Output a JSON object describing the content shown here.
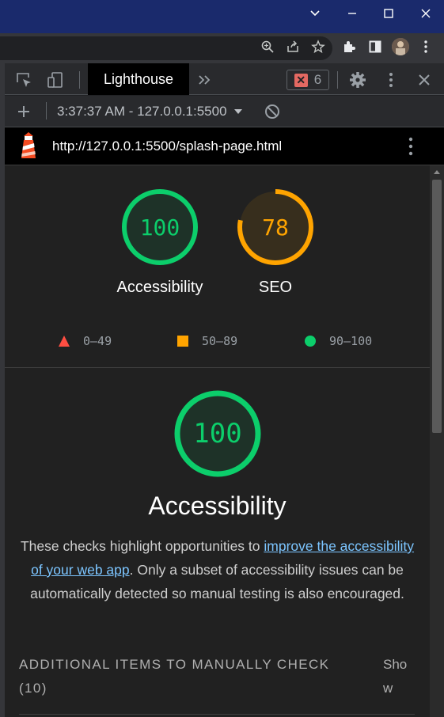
{
  "devtools": {
    "panel_tab": "Lighthouse",
    "error_count": "6",
    "report_selector": "3:37:37 AM - 127.0.0.1:5500",
    "url": "http://127.0.0.1:5500/splash-page.html"
  },
  "summary": {
    "gauges": [
      {
        "score": "100",
        "label": "Accessibility",
        "value": 100,
        "color": "#0cce6b"
      },
      {
        "score": "78",
        "label": "SEO",
        "value": 78,
        "color": "#ffa400"
      }
    ],
    "legend": [
      {
        "range": "0–49",
        "color": "#ff4e42",
        "icon": "triangle"
      },
      {
        "range": "50–89",
        "color": "#ffa400",
        "icon": "square"
      },
      {
        "range": "90–100",
        "color": "#0cce6b",
        "icon": "circle"
      }
    ]
  },
  "category": {
    "score": "100",
    "value": 100,
    "title": "Accessibility",
    "desc_before": "These checks highlight opportunities to ",
    "desc_link": "improve the accessibility of your web app",
    "desc_after": ". Only a subset of accessibility issues can be automatically detected so manual testing is also encouraged.",
    "manual_heading": "ADDITIONAL ITEMS TO MANUALLY CHECK",
    "manual_count": "(10)",
    "show_label": "Show"
  },
  "icons": [
    "chevron-down-icon",
    "minimize-icon",
    "maximize-icon",
    "close-icon",
    "zoom-icon",
    "share-icon",
    "star-icon",
    "extensions-icon",
    "sidebar-icon",
    "avatar",
    "kebab-icon",
    "inspect-icon",
    "device-icon",
    "more-tabs-icon",
    "gear-icon",
    "plus-icon",
    "block-icon",
    "lighthouse-logo"
  ]
}
